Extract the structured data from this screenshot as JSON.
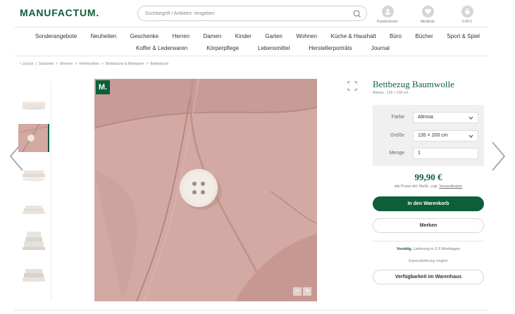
{
  "brand": {
    "logo": "MANUFACTUM."
  },
  "search": {
    "placeholder": "Suchbegriff / Artikelnr. eingeben"
  },
  "account": [
    {
      "label": "Kundenkonto",
      "icon": "user-icon"
    },
    {
      "label": "Merkliste",
      "icon": "heart-icon"
    },
    {
      "label": "0,00 €",
      "icon": "cart-icon"
    }
  ],
  "nav": {
    "row1": [
      "Sonderangebote",
      "Neuheiten",
      "Geschenke",
      "Herren",
      "Damen",
      "Kinder",
      "Garten",
      "Wohnen",
      "Küche & Haushalt",
      "Büro",
      "Bücher",
      "Sport & Spiel"
    ],
    "row2": [
      "Koffer & Lederwaren",
      "Körperpflege",
      "Lebensmittel",
      "Herstellerporträts",
      "Journal"
    ]
  },
  "breadcrumb": [
    "< Zurück",
    "|",
    "Startseite",
    ">",
    "Wohnen",
    ">",
    "Heimtextilien",
    ">",
    "Bettwäsche & Bettwaren",
    ">",
    "Bettwäsche"
  ],
  "gallery": {
    "badge": "M.",
    "zoom_minus": "−",
    "zoom_plus": "+"
  },
  "product": {
    "title": "Bettbezug Baumwolle",
    "subtitle": "Altrosa · 135 × 200 cm",
    "options": {
      "color_label": "Farbe",
      "color_value": "Altrosa",
      "size_label": "Größe",
      "size_value": "135 × 200 cm",
      "qty_label": "Menge",
      "qty_value": "1"
    },
    "price": "99,90 €",
    "price_note": "alle Preise inkl. MwSt., zzgl.",
    "price_note_link": "Versandkosten",
    "add_to_cart": "In den Warenkorb",
    "wishlist": "Merken",
    "availability_status": "Vorrätig",
    "availability_text": ", Lieferung in 2-3 Werktagen",
    "express": "Expresslieferung möglich",
    "store_availability": "Verfügbarkeit im Warenhaus"
  },
  "colors": {
    "brand_green": "#0d5f3a",
    "product_pink": "#d2a8a1"
  }
}
